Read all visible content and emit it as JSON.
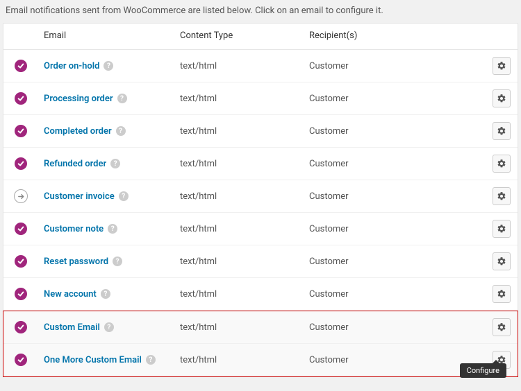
{
  "intro": "Email notifications sent from WooCommerce are listed below. Click on an email to configure it.",
  "columns": {
    "email": "Email",
    "ctype": "Content Type",
    "recipients": "Recipient(s)"
  },
  "help_char": "?",
  "tooltip": "Configure",
  "rows": [
    {
      "name": "Order on-hold",
      "ctype": "text/html",
      "recip": "Customer",
      "status": "enabled",
      "highlighted": false
    },
    {
      "name": "Processing order",
      "ctype": "text/html",
      "recip": "Customer",
      "status": "enabled",
      "highlighted": false
    },
    {
      "name": "Completed order",
      "ctype": "text/html",
      "recip": "Customer",
      "status": "enabled",
      "highlighted": false
    },
    {
      "name": "Refunded order",
      "ctype": "text/html",
      "recip": "Customer",
      "status": "enabled",
      "highlighted": false
    },
    {
      "name": "Customer invoice",
      "ctype": "text/html",
      "recip": "Customer",
      "status": "manual",
      "highlighted": false
    },
    {
      "name": "Customer note",
      "ctype": "text/html",
      "recip": "Customer",
      "status": "enabled",
      "highlighted": false
    },
    {
      "name": "Reset password",
      "ctype": "text/html",
      "recip": "Customer",
      "status": "enabled",
      "highlighted": false
    },
    {
      "name": "New account",
      "ctype": "text/html",
      "recip": "Customer",
      "status": "enabled",
      "highlighted": false
    },
    {
      "name": "Custom Email",
      "ctype": "text/html",
      "recip": "Customer",
      "status": "enabled",
      "highlighted": true
    },
    {
      "name": "One More Custom Email",
      "ctype": "text/html",
      "recip": "Customer",
      "status": "enabled",
      "highlighted": true,
      "tooltip": true
    }
  ]
}
